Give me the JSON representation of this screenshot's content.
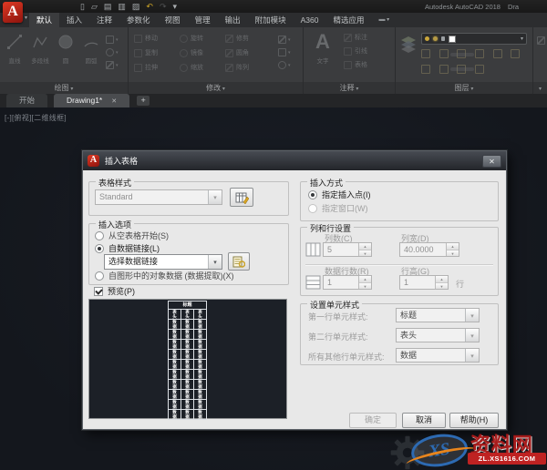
{
  "titlebar": {
    "app_title": "Autodesk AutoCAD 2018",
    "doc_title_partial": "Dra"
  },
  "qat": {
    "icons": [
      "new",
      "open",
      "save",
      "plot",
      "print",
      "undo",
      "redo",
      "customize"
    ]
  },
  "ribbon": {
    "tabs": [
      "默认",
      "插入",
      "注释",
      "参数化",
      "视图",
      "管理",
      "输出",
      "附加模块",
      "A360",
      "精选应用"
    ],
    "active_tab_index": 0,
    "panels": [
      {
        "label": "绘图",
        "tools": [
          "直线",
          "多段线",
          "圆",
          "圆弧"
        ]
      },
      {
        "label": "修改",
        "tools": [
          "移动",
          "旋转",
          "修剪",
          "复制",
          "镜像",
          "圆角",
          "拉伸",
          "缩放",
          "阵列"
        ]
      },
      {
        "label": "注释",
        "tools": [
          "文字",
          "标注",
          "引线",
          "表格"
        ]
      },
      {
        "label": "图层"
      }
    ]
  },
  "file_tabs": {
    "start_label": "开始",
    "drawing_label": "Drawing1*"
  },
  "viewport_label": "[-][俯视][二维线框]",
  "dialog": {
    "title": "插入表格",
    "table_style": {
      "group_label": "表格样式",
      "style_value": "Standard"
    },
    "insert_options": {
      "group_label": "插入选项",
      "option_empty": "从空表格开始(S)",
      "option_datalink": "自数据链接(L)",
      "datalink_value": "选择数据链接",
      "option_object_data": "自图形中的对象数据 (数据提取)(X)"
    },
    "preview_label": "预览(P)",
    "preview_table": {
      "title": "标题",
      "header": "表头",
      "data": "数据",
      "columns": 3,
      "data_rows": 10
    },
    "insertion_behavior": {
      "group_label": "插入方式",
      "option_point": "指定插入点(I)",
      "option_window": "指定窗口(W)"
    },
    "col_row": {
      "group_label": "列和行设置",
      "columns_label": "列数(C)",
      "columns_value": "5",
      "col_width_label": "列宽(D)",
      "col_width_value": "40.0000",
      "data_rows_label": "数据行数(R)",
      "data_rows_value": "1",
      "row_height_label": "行高(G)",
      "row_height_value": "1",
      "row_height_suffix": "行"
    },
    "cell_styles": {
      "group_label": "设置单元样式",
      "rows": [
        {
          "label": "第一行单元样式:",
          "value": "标题"
        },
        {
          "label": "第二行单元样式:",
          "value": "表头"
        },
        {
          "label": "所有其他行单元样式:",
          "value": "数据"
        }
      ]
    },
    "buttons": {
      "ok": "确定",
      "cancel": "取消",
      "help": "帮助(H)"
    }
  },
  "watermark": {
    "logo_text": "XS",
    "site_name": "资料网",
    "site_url": "ZL.XS1616.COM",
    "accent_red": "#bf2222",
    "accent_blue": "#2d6ab2",
    "accent_orange": "#e8851d"
  }
}
